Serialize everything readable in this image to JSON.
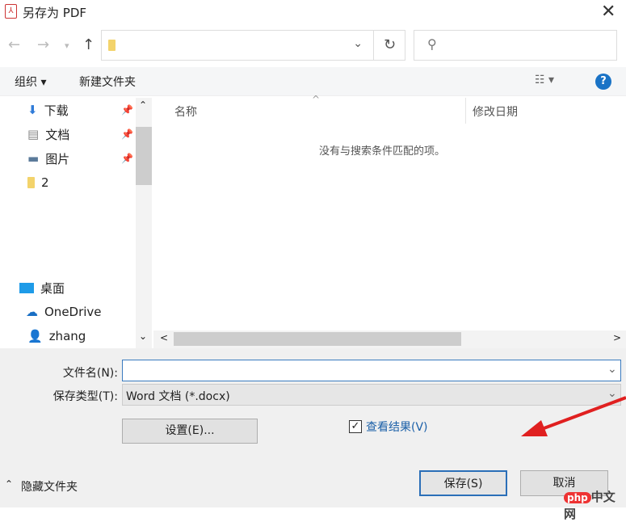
{
  "window": {
    "title": "另存为 PDF"
  },
  "nav": {
    "back": "←",
    "forward": "→",
    "recent": "▾",
    "up": "↑",
    "refresh": "↻",
    "search_icon": "⚲"
  },
  "toolbar": {
    "organize": "组织 ▾",
    "new_folder": "新建文件夹",
    "view": "☷ ▾",
    "help": "?"
  },
  "sidebar": {
    "items": [
      {
        "label": "下载",
        "icon": "download-icon",
        "pinned": true
      },
      {
        "label": "文档",
        "icon": "document-icon",
        "pinned": true
      },
      {
        "label": "图片",
        "icon": "pictures-icon",
        "pinned": true
      },
      {
        "label": "2",
        "icon": "folder-icon",
        "pinned": false
      },
      {
        "label": "桌面",
        "icon": "desktop-icon",
        "pinned": false
      },
      {
        "label": "OneDrive",
        "icon": "onedrive-icon",
        "pinned": false
      },
      {
        "label": "zhang",
        "icon": "user-icon",
        "pinned": false
      }
    ]
  },
  "file_list": {
    "columns": [
      "名称",
      "修改日期"
    ],
    "empty_message": "没有与搜索条件匹配的项。"
  },
  "form": {
    "filename_label": "文件名(N):",
    "filename_value": "",
    "type_label": "保存类型(T):",
    "type_value": "Word 文档 (*.docx)",
    "settings_button": "设置(E)...",
    "view_result_label": "查看结果(V)",
    "view_result_checked": true
  },
  "footer": {
    "hide_folders": "隐藏文件夹",
    "save": "保存(S)",
    "cancel": "取消"
  },
  "watermark": {
    "php": "php",
    "site": "中文网"
  },
  "colors": {
    "accent": "#1a73c6",
    "arrow": "#e02020"
  }
}
